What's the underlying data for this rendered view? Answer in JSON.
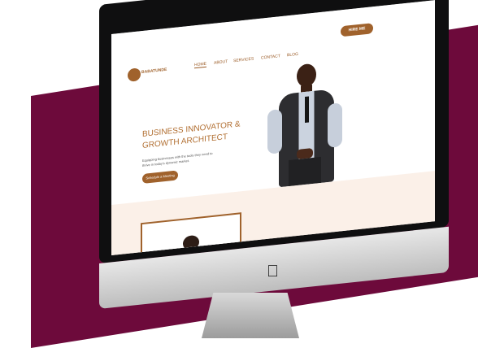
{
  "site": {
    "brand": "BABATUNDE",
    "nav": [
      "HOME",
      "ABOUT",
      "SERVICES",
      "CONTACT",
      "BLOG"
    ],
    "hire": "HIRE ME",
    "hero": {
      "title1": "BUSINESS INNOVATOR &",
      "title2": "GROWTH ARCHITECT",
      "subtitle1": "Equipping businesses with the tools they need to",
      "subtitle2": "thrive in today's dynamic market.",
      "cta": "Schedule a Meeting"
    }
  },
  "colors": {
    "accent": "#a0622c",
    "maroon": "#6d0a3b",
    "cream": "#fbf0e8"
  }
}
